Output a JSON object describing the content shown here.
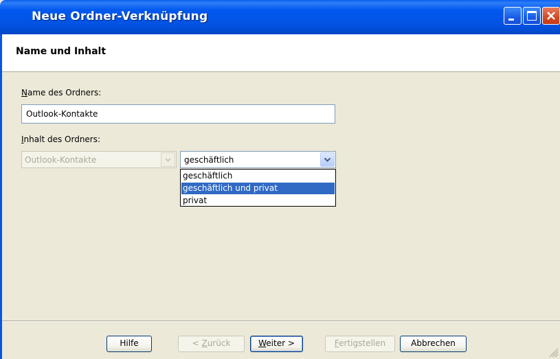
{
  "window": {
    "title": "Neue Ordner-Verknüpfung"
  },
  "header": {
    "title": "Name und Inhalt"
  },
  "form": {
    "name_label_access": "N",
    "name_label_rest": "ame des Ordners:",
    "name_value": "Outlook-Kontakte",
    "content_label_access": "I",
    "content_label_rest": "nhalt des Ordners:",
    "source_combo_value": "Outlook-Kontakte",
    "type_combo_value": "geschäftlich",
    "type_options": [
      "geschäftlich",
      "geschäftlich und privat",
      "privat"
    ],
    "type_highlighted_index": 1
  },
  "buttons": {
    "help": "Hilfe",
    "back_prefix": "< ",
    "back_access": "Z",
    "back_rest": "urück",
    "next_access": "W",
    "next_rest": "eiter >",
    "finish_access": "F",
    "finish_rest": "ertigstellen",
    "cancel": "Abbrechen"
  },
  "icons": [
    "minimize-icon",
    "maximize-icon",
    "close-icon",
    "chevron-down-icon",
    "resize-grip-icon"
  ]
}
